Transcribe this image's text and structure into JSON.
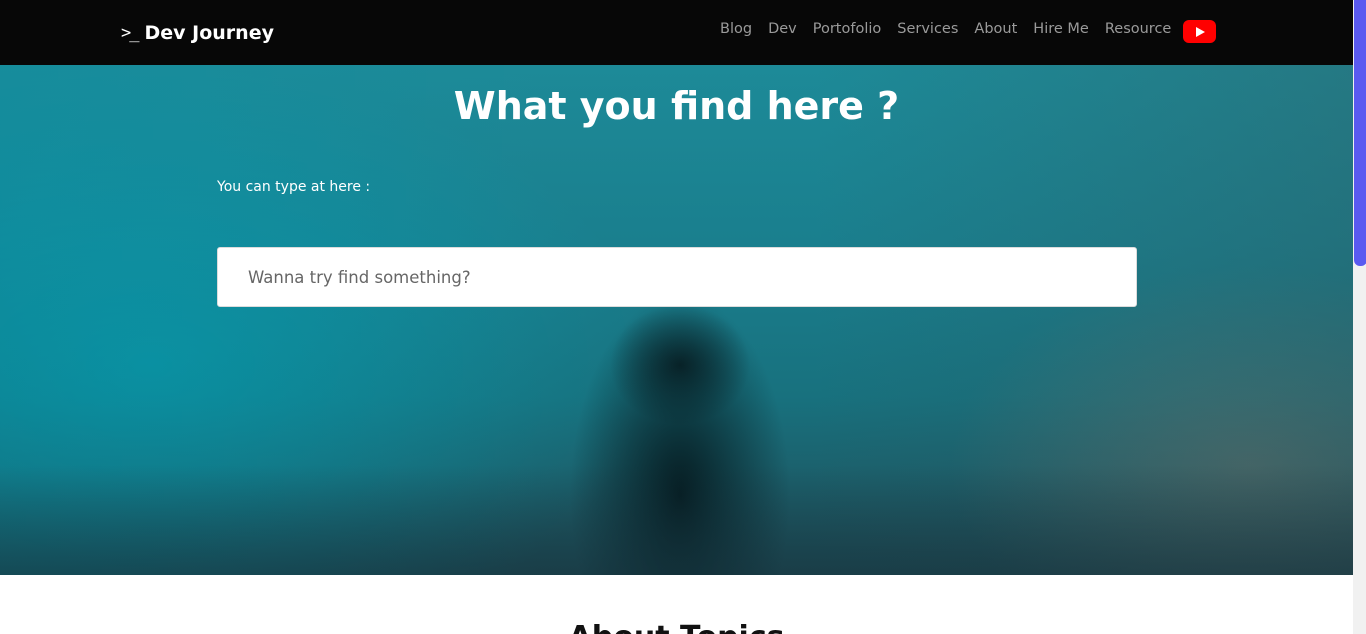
{
  "brand": {
    "prompt": ">_",
    "title": "Dev Journey"
  },
  "nav": {
    "links": [
      "Blog",
      "Dev",
      "Portofolio",
      "Services",
      "About",
      "Hire Me",
      "Resource"
    ],
    "youtube_icon": "youtube-icon",
    "youtube_color": "#ff0000"
  },
  "hero": {
    "title": "What you find here ?",
    "label": "You can type at here :",
    "search_placeholder": "Wanna try find something?"
  },
  "next_section": {
    "heading": "About Topics"
  },
  "colors": {
    "navbar": "#070707",
    "hero": "#1a7f8e",
    "scrollbar_thumb": "#5a5af0"
  }
}
